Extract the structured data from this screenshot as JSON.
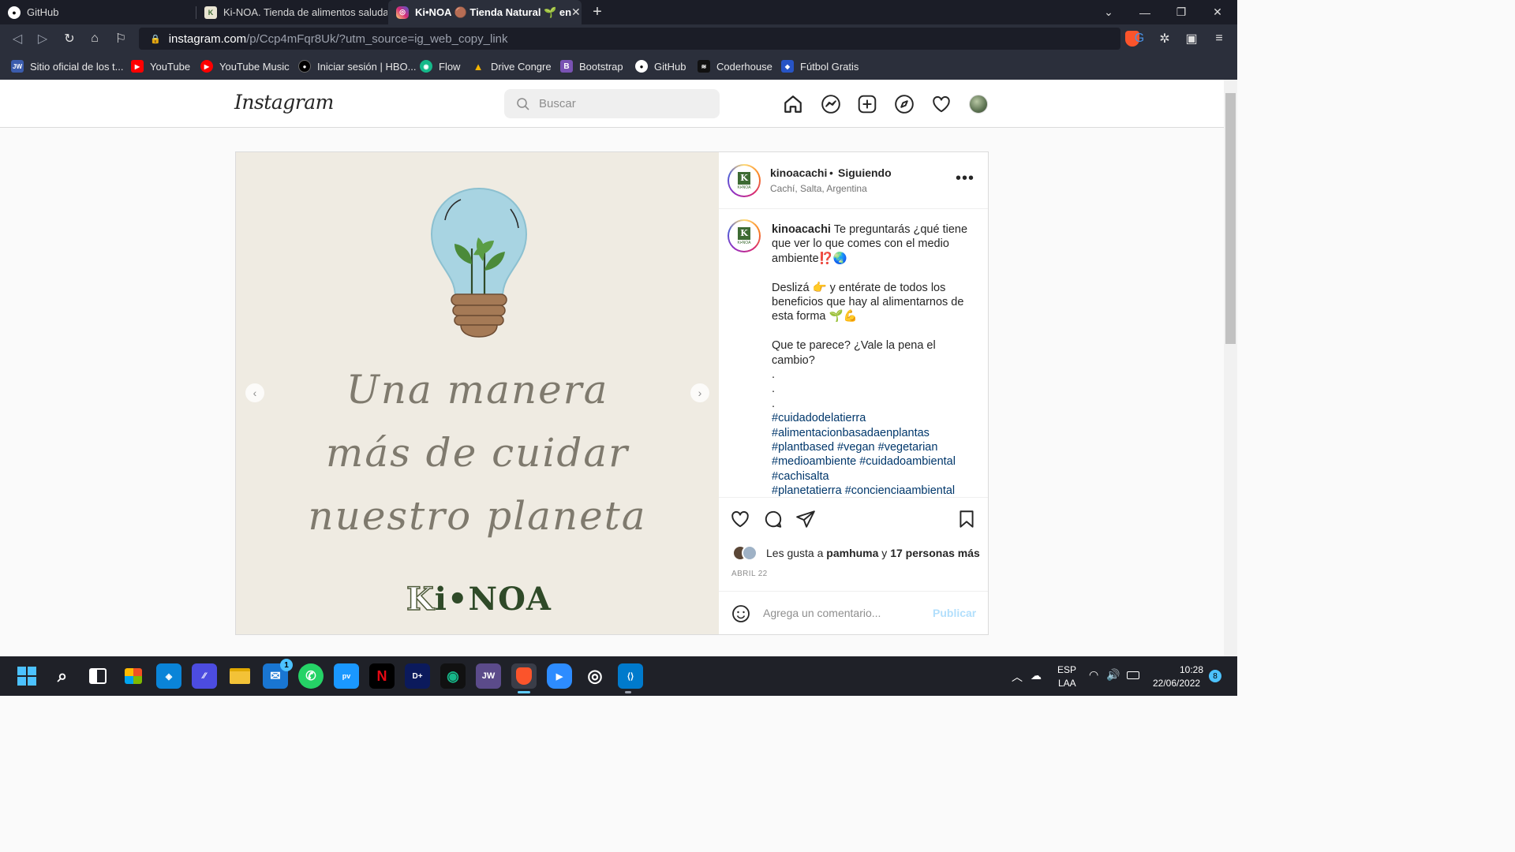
{
  "browser": {
    "tabs": [
      {
        "title": "GitHub",
        "active": false
      },
      {
        "title": "Ki-NOA. Tienda de alimentos saludables",
        "active": false
      },
      {
        "title": "Ki•NOA 🟤 Tienda Natural 🌱 en",
        "active": true
      }
    ],
    "new_tab_label": "+",
    "url_host": "instagram.com",
    "url_path": "/p/Ccp4mFqr8Uk/?utm_source=ig_web_copy_link",
    "bookmarks": [
      {
        "label": "Sitio oficial de los t...",
        "icon": "JW",
        "color": "#3b5cad"
      },
      {
        "label": "YouTube",
        "icon": "▶",
        "color": "#ff0000"
      },
      {
        "label": "YouTube Music",
        "icon": "▶",
        "color": "#ff0000"
      },
      {
        "label": "Iniciar sesión | HBO...",
        "icon": "●",
        "color": "#000000"
      },
      {
        "label": "Flow",
        "icon": "◉",
        "color": "#16b98a"
      },
      {
        "label": "Drive Congre",
        "icon": "▲",
        "color": "#f4b400"
      },
      {
        "label": "Bootstrap",
        "icon": "B",
        "color": "#7952b3"
      },
      {
        "label": "GitHub",
        "icon": "●",
        "color": "#24292e"
      },
      {
        "label": "Coderhouse",
        "icon": "≋",
        "color": "#111111"
      },
      {
        "label": "Fútbol Gratis",
        "icon": "◆",
        "color": "#2754c5"
      }
    ]
  },
  "instagram": {
    "logo_text": "Instagram",
    "search_placeholder": "Buscar",
    "post": {
      "image_text_lines": [
        "Una manera",
        "más de cuidar",
        "nuestro planeta"
      ],
      "image_brand_k": "K",
      "image_brand_rest": "i•NOA",
      "username": "kinoacachi",
      "follow_status": "Siguiendo",
      "dot": "•",
      "location": "Cachí, Salta, Argentina",
      "avatar_letter": "K",
      "avatar_brand": "Ki•NOA",
      "caption_intro": "Te preguntarás ¿qué tiene que ver lo que comes con el medio ambiente⁉️🌏",
      "caption_p2": "Deslizá 👉 y entérate de todos los beneficios que hay al alimentarnos de esta forma 🌱💪",
      "caption_p3": "Que te parece? ¿Vale la pena el cambio?",
      "caption_dots": [
        ".",
        ".",
        "."
      ],
      "hashtags": [
        "#cuidadodelatierra",
        "#alimentacionbasadaenplantas",
        "#plantbased #vegan #vegetarian",
        "#medioambiente #cuidadoambiental",
        "#cachisalta",
        "#planetatierra #concienciaambiental"
      ],
      "likes_prefix": "Les gusta a",
      "likes_user": "pamhuma",
      "likes_and": "y",
      "likes_others": "17 personas más",
      "date": "ABRIL 22",
      "comment_placeholder": "Agrega un comentario...",
      "publish_label": "Publicar"
    }
  },
  "taskbar": {
    "apps": [
      {
        "name": "windows-start",
        "glyph": "⊞",
        "color": "transparent"
      },
      {
        "name": "search",
        "glyph": "⌕",
        "color": "transparent"
      },
      {
        "name": "task-view",
        "glyph": "❐",
        "color": "transparent"
      },
      {
        "name": "store",
        "glyph": "▦",
        "color": "transparent"
      },
      {
        "name": "app-blue",
        "glyph": "◈",
        "color": "#0a84d8"
      },
      {
        "name": "app-ai",
        "glyph": "⁄⁄",
        "color": "#4c4ce0"
      },
      {
        "name": "file-explorer",
        "glyph": "▬",
        "color": "#f3c237"
      },
      {
        "name": "mail",
        "glyph": "✉",
        "color": "#1976d2"
      },
      {
        "name": "whatsapp",
        "glyph": "✆",
        "color": "#25d366"
      },
      {
        "name": "prime-video",
        "glyph": "pv",
        "color": "#1a98ff"
      },
      {
        "name": "netflix",
        "glyph": "N",
        "color": "#000000"
      },
      {
        "name": "disney-plus",
        "glyph": "D+",
        "color": "#0b1a5c"
      },
      {
        "name": "flow",
        "glyph": "◉",
        "color": "#111111"
      },
      {
        "name": "jw",
        "glyph": "JW",
        "color": "#5b4b8a"
      },
      {
        "name": "brave",
        "glyph": "🦁",
        "color": "#fb542b"
      },
      {
        "name": "zoom",
        "glyph": "▶",
        "color": "#2d8cff"
      },
      {
        "name": "obs",
        "glyph": "◎",
        "color": "#3a3a3a"
      },
      {
        "name": "vscode",
        "glyph": "⟨⟩",
        "color": "#007acc"
      }
    ],
    "mail_badge": "1",
    "language": "ESP",
    "keyboard": "LAA",
    "time": "10:28",
    "date": "22/06/2022",
    "notification_count": "8"
  },
  "colors": {
    "accent_blue": "#0095f6",
    "hashtag": "#00376b",
    "publish_disabled": "#b2dffc"
  }
}
